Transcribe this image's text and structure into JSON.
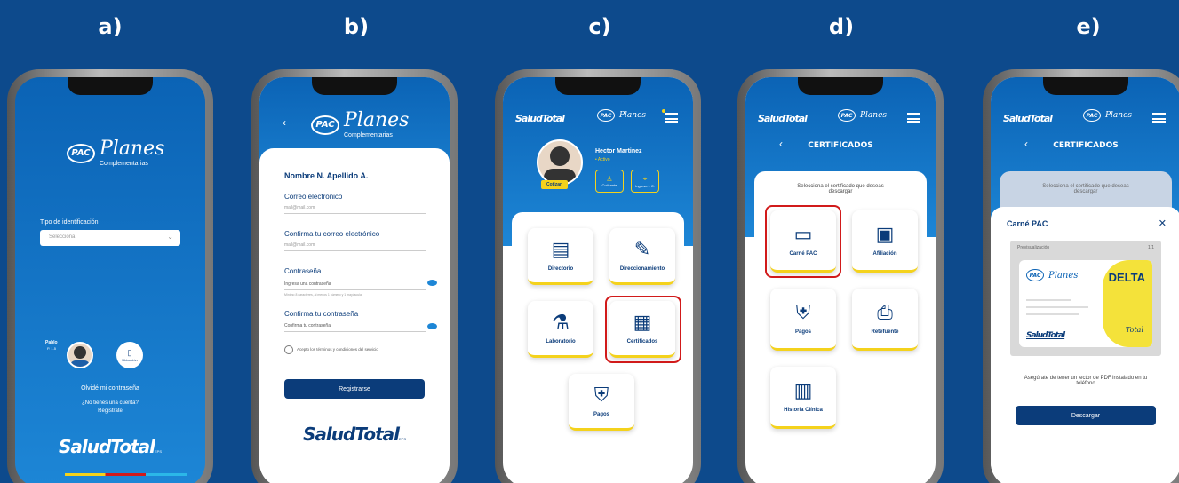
{
  "labels": [
    "a)",
    "b)",
    "c)",
    "d)",
    "e)"
  ],
  "brand": {
    "planes": "Planes",
    "complementarias": "Complementarias",
    "pac": "PAC",
    "salud_total": "SaludTotal",
    "salud_total_suffix": "EPS",
    "colors": {
      "blue": "#0d4a8c",
      "yellow": "#f4d21c",
      "red": "#d11a1a"
    }
  },
  "a": {
    "id_type_label": "Tipo de identificación",
    "id_type_value": "Selecciona",
    "avatar_name": "Pablo",
    "avatar_sub": "P. 1.5",
    "option_button": "Ubicación",
    "forgot": "Olvidé mi contraseña",
    "no_account": "¿No tienes una cuenta?",
    "register": "Regístrate"
  },
  "b": {
    "back": "‹",
    "user_name": "Nombre N. Apellido A.",
    "email_label": "Correo electrónico",
    "email_value": "mail@mail.com",
    "confirm_email_label": "Confirma tu correo electrónico",
    "confirm_email_value": "mail@mail.com",
    "password_label": "Contraseña",
    "password_placeholder": "Ingresa una contraseña",
    "password_hint": "Mínimo 8 caracteres, al menos 1 número y 1 mayúscula",
    "confirm_password_label": "Confirma tu contraseña",
    "confirm_password_placeholder": "Confirma tu contraseña",
    "terms": "Acepto los términos y condiciones del servicio",
    "register_button": "Registrarse"
  },
  "c": {
    "user_name": "Hector Martinez",
    "status": "• Activo",
    "avatar_tag": "Cotizan",
    "chip1": "Cotizante",
    "chip2": "Ingreso 1 C.",
    "tiles": [
      "Directorio",
      "Direccionamiento",
      "Laboratorio",
      "Certificados",
      "Pagos"
    ]
  },
  "d": {
    "back": "‹",
    "title": "CERTIFICADOS",
    "prompt": "Selecciona el certificado que deseas descargar",
    "tiles": [
      "Carné PAC",
      "Afiliación",
      "Pagos",
      "Retefuente",
      "Historia Clínica"
    ]
  },
  "e": {
    "back": "‹",
    "title": "CERTIFICADOS",
    "prompt": "Selecciona el certificado que deseas descargar",
    "modal_title": "Carné PAC",
    "close": "✕",
    "preview_label": "Previsualización",
    "page_count": "1/1",
    "card_plan": "DELTA",
    "card_total": "Total",
    "pdf_note": "Asegúrate de tener un lector de PDF instalado en tu teléfono",
    "download_button": "Descargar"
  }
}
